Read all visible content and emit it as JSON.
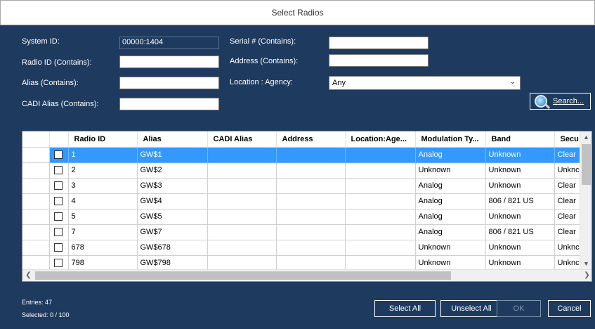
{
  "window": {
    "title": "Select Radios"
  },
  "filters": {
    "system_id_label": "System ID:",
    "system_id_value": "00000:1404",
    "radio_id_label": "Radio ID (Contains):",
    "radio_id_value": "",
    "alias_label": "Alias (Contains):",
    "alias_value": "",
    "cadi_alias_label": "CADI Alias (Contains):",
    "cadi_alias_value": "",
    "serial_label": "Serial # (Contains):",
    "serial_value": "",
    "address_label": "Address (Contains):",
    "address_value": "",
    "location_label": "Location : Agency:",
    "location_value": "Any",
    "search_label": "Search..."
  },
  "grid": {
    "columns": [
      "Radio ID",
      "Alias",
      "CADI Alias",
      "Address",
      "Location:Age...",
      "Modulation Ty...",
      "Band",
      "Secu"
    ],
    "rows": [
      {
        "radio_id": "1",
        "alias": "GW$1",
        "cadi": "",
        "address": "",
        "location": "",
        "modulation": "Analog",
        "band": "Unknown",
        "security": "Clear",
        "selected": true
      },
      {
        "radio_id": "2",
        "alias": "GW$2",
        "cadi": "",
        "address": "",
        "location": "",
        "modulation": "Unknown",
        "band": "Unknown",
        "security": "Unknc",
        "selected": false
      },
      {
        "radio_id": "3",
        "alias": "GW$3",
        "cadi": "",
        "address": "",
        "location": "",
        "modulation": "Analog",
        "band": "Unknown",
        "security": "Clear",
        "selected": false
      },
      {
        "radio_id": "4",
        "alias": "GW$4",
        "cadi": "",
        "address": "",
        "location": "",
        "modulation": "Analog",
        "band": "806 / 821 US",
        "security": "Clear",
        "selected": false
      },
      {
        "radio_id": "5",
        "alias": "GW$5",
        "cadi": "",
        "address": "",
        "location": "",
        "modulation": "Analog",
        "band": "Unknown",
        "security": "Clear",
        "selected": false
      },
      {
        "radio_id": "7",
        "alias": "GW$7",
        "cadi": "",
        "address": "",
        "location": "",
        "modulation": "Analog",
        "band": "806 / 821 US",
        "security": "Clear",
        "selected": false
      },
      {
        "radio_id": "678",
        "alias": "GW$678",
        "cadi": "",
        "address": "",
        "location": "",
        "modulation": "Unknown",
        "band": "Unknown",
        "security": "Unknc",
        "selected": false
      },
      {
        "radio_id": "798",
        "alias": "GW$798",
        "cadi": "",
        "address": "",
        "location": "",
        "modulation": "Unknown",
        "band": "Unknown",
        "security": "Unknc",
        "selected": false
      }
    ]
  },
  "status": {
    "entries": "Entries: 47",
    "selected": "Selected: 0 / 100"
  },
  "buttons": {
    "select_all": "Select All",
    "unselect_all": "Unselect All",
    "ok": "OK",
    "cancel": "Cancel"
  },
  "colors": {
    "dialog_bg": "#1e3a5f",
    "selection": "#3399ff"
  }
}
